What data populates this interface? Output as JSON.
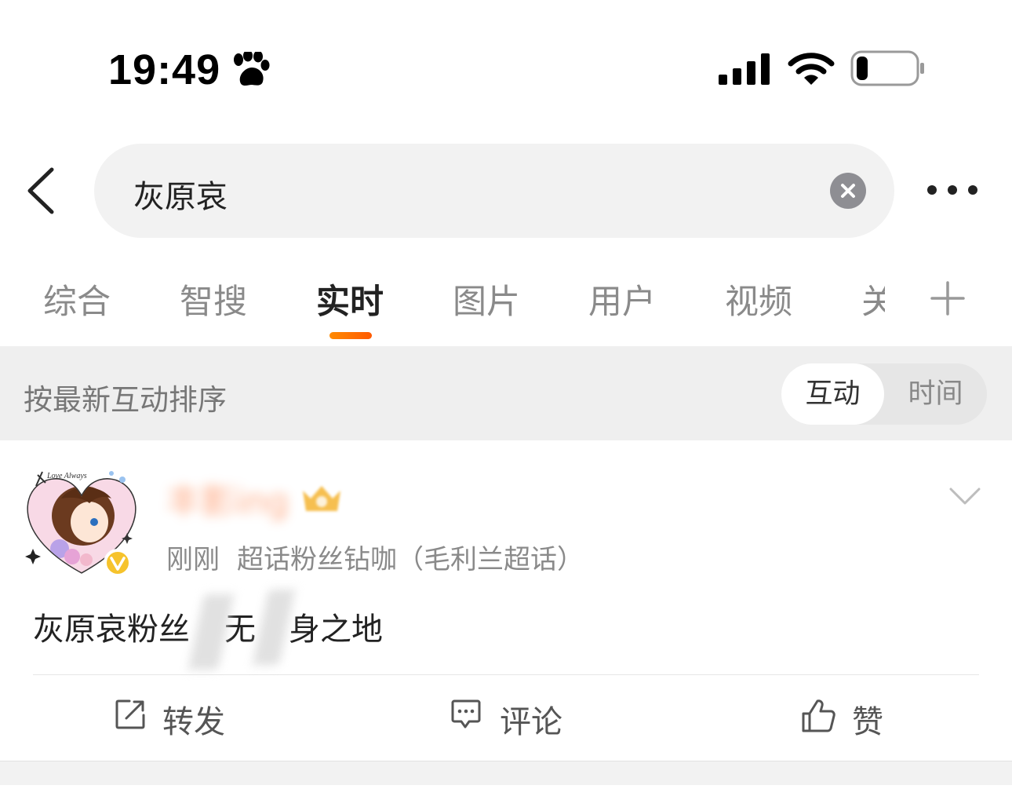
{
  "status_bar": {
    "time": "19:49",
    "icons": [
      "paw-icon",
      "signal-icon",
      "wifi-icon",
      "battery-icon"
    ],
    "battery_level": 0.2
  },
  "search": {
    "query": "灰原哀",
    "icons": [
      "back-arrow-icon",
      "clear-icon",
      "more-icon"
    ]
  },
  "tabs": {
    "items": [
      "综合",
      "智搜",
      "实时",
      "图片",
      "用户",
      "视频",
      "关"
    ],
    "active": "实时",
    "add_icon": "plus-icon",
    "accent_color": "#ff6a00"
  },
  "sort": {
    "label": "按最新互动排序",
    "options": [
      "互动",
      "时间"
    ],
    "active": "互动"
  },
  "post": {
    "username": "丰影ing",
    "time": "刚刚",
    "source": "超话粉丝钻咖（毛利兰超话）",
    "content": "灰原哀粉丝 无 身之地",
    "content_parts": [
      "灰原哀粉丝",
      "无",
      "身之地"
    ],
    "badge_icons": [
      "avatar",
      "verified-badge-icon",
      "crown-badge-icon",
      "chevron-down-icon"
    ],
    "actions": {
      "repost": "转发",
      "comment": "评论",
      "like": "赞"
    }
  }
}
